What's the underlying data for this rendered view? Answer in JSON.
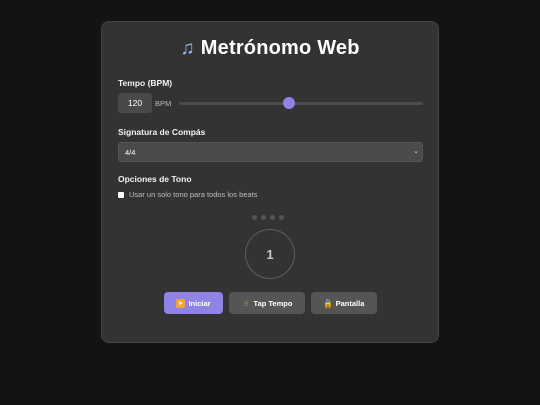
{
  "app": {
    "title": "Metrónomo Web",
    "title_icon": "music-note-icon"
  },
  "tempo": {
    "label": "Tempo (BPM)",
    "value": "120",
    "unit": "BPM",
    "slider_fraction": 0.45
  },
  "time_signature": {
    "label": "Signatura de Compás",
    "selected": "4/4"
  },
  "tone_options": {
    "label": "Opciones de Tono",
    "single_tone_label": "Usar un solo tono para todos los beats",
    "single_tone_checked": false
  },
  "beat_indicator": {
    "dots": 4,
    "current_beat": "1"
  },
  "buttons": {
    "start": {
      "label": "Iniciar",
      "icon": "play-icon"
    },
    "tap": {
      "label": "Tap Tempo",
      "icon": "pointing-hand-icon"
    },
    "screen": {
      "label": "Pantalla",
      "icon": "lock-icon"
    }
  },
  "colors": {
    "accent": "#8f84e6",
    "background": "#131313",
    "card": "#333333"
  }
}
